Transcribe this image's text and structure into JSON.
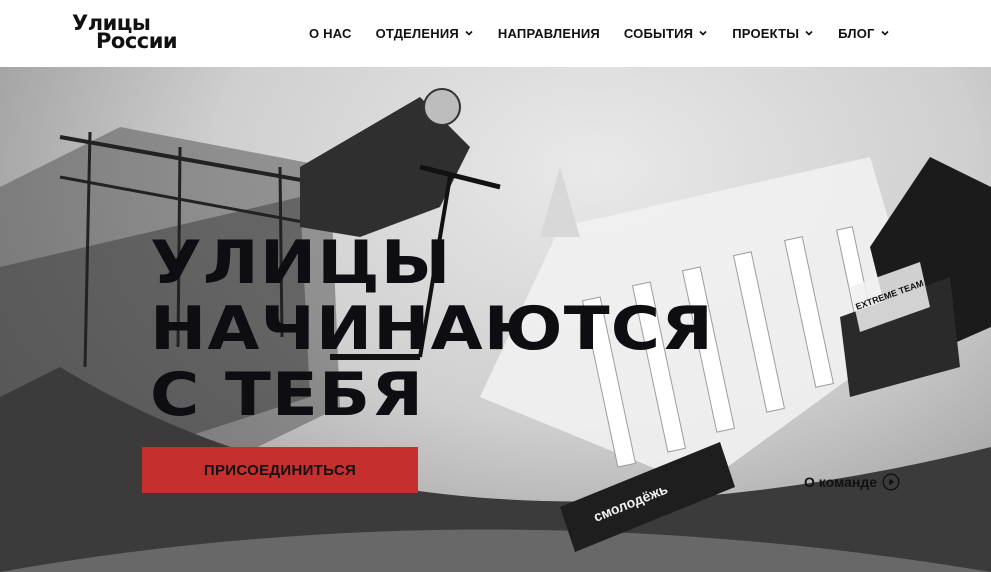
{
  "logo": {
    "line1": "Улицы",
    "line2": "России"
  },
  "nav": {
    "items": [
      {
        "label": "О НАС"
      },
      {
        "label": "ОТДЕЛЕНИЯ"
      },
      {
        "label": "НАПРАВЛЕНИЯ"
      },
      {
        "label": "СОБЫТИЯ"
      },
      {
        "label": "ПРОЕКТЫ"
      },
      {
        "label": "БЛОГ"
      }
    ]
  },
  "hero": {
    "headline_line1": "УЛИЦЫ",
    "headline_line2": "НАЧИНАЮТСЯ",
    "headline_line3": "С ТЕБЯ",
    "cta_label": "ПРИСОЕДИНИТЬСЯ",
    "team_link_label": "О команде",
    "banner_text_1": "смолодёжь",
    "banner_text_2": "EXTREME TEAM"
  },
  "colors": {
    "accent": "#c5302f",
    "text": "#111111",
    "header_bg": "#ffffff"
  }
}
